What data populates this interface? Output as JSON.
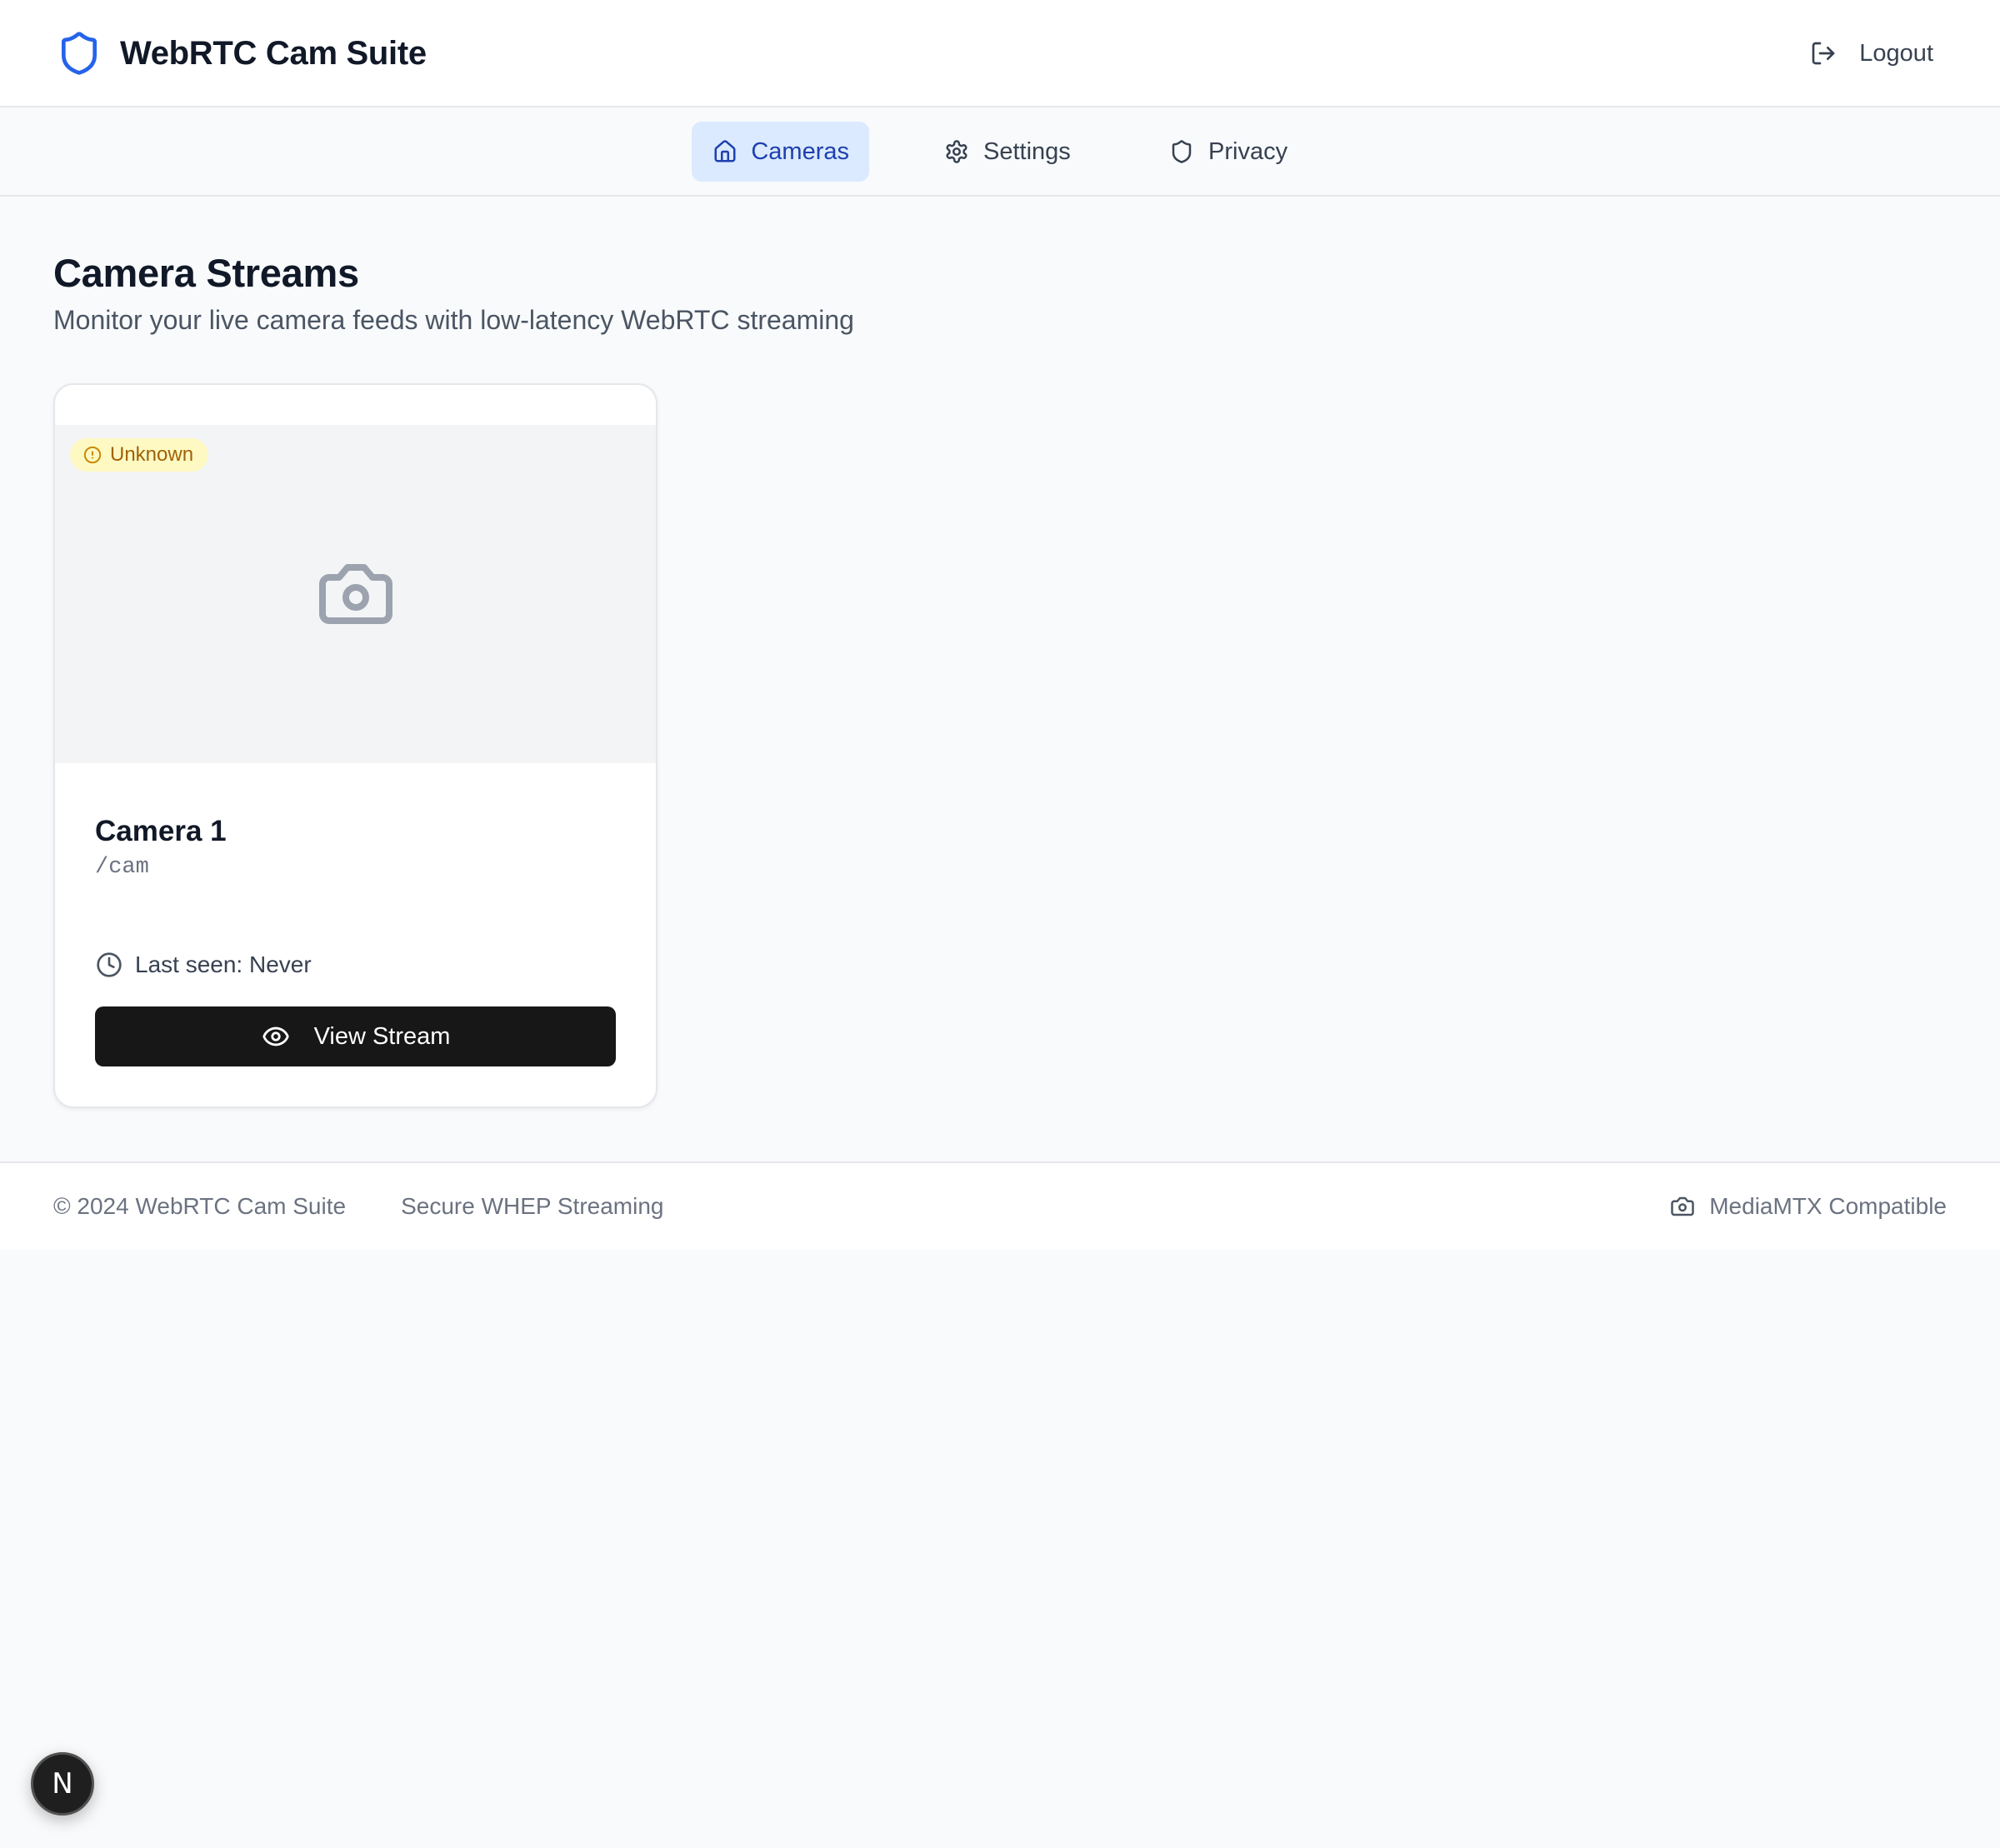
{
  "header": {
    "title": "WebRTC Cam Suite",
    "logout_label": "Logout",
    "brand_color": "#2563eb"
  },
  "nav": {
    "tabs": [
      {
        "label": "Cameras",
        "icon": "home-icon",
        "active": true
      },
      {
        "label": "Settings",
        "icon": "gear-icon",
        "active": false
      },
      {
        "label": "Privacy",
        "icon": "shield-icon",
        "active": false
      }
    ]
  },
  "main": {
    "title": "Camera Streams",
    "subtitle": "Monitor your live camera feeds with low-latency WebRTC streaming",
    "cameras": [
      {
        "name": "Camera 1",
        "path": "/cam",
        "status": "Unknown",
        "status_color": "#a16207",
        "last_seen": "Last seen: Never",
        "action_label": "View Stream"
      }
    ]
  },
  "footer": {
    "copyright": "© 2024 WebRTC Cam Suite",
    "tagline": "Secure WHEP Streaming",
    "compat": "MediaMTX Compatible"
  },
  "dev_indicator": {
    "letter": "N"
  }
}
